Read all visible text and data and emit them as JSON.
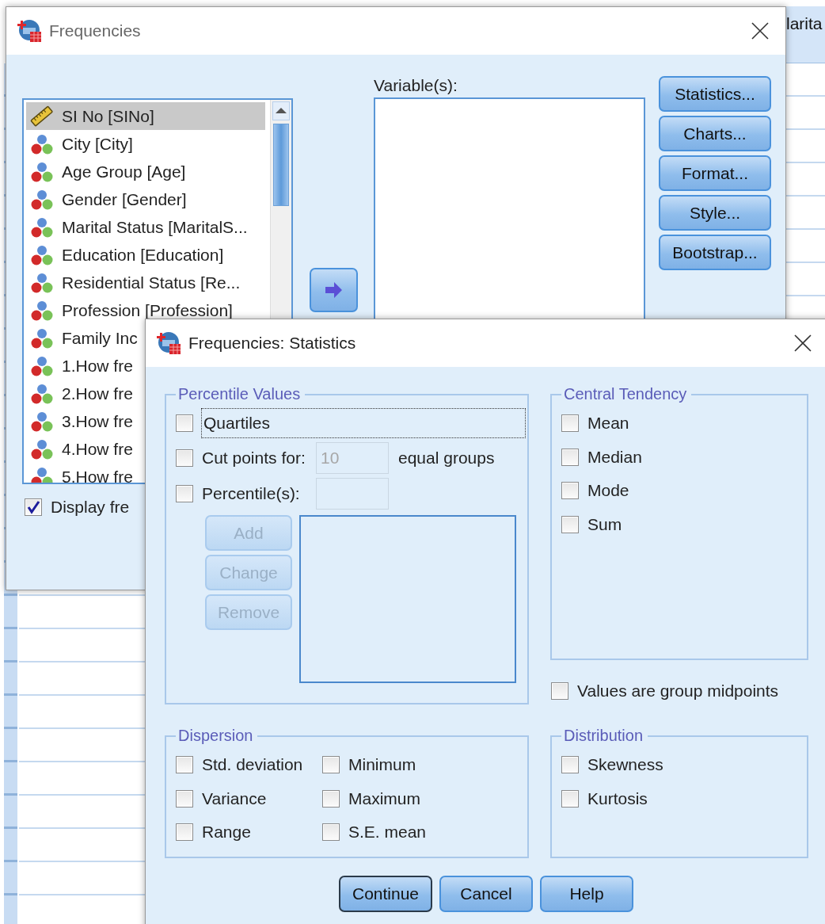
{
  "background_sheet": {
    "column_header": "larita"
  },
  "main_dialog": {
    "title": "Frequencies",
    "source_variables": [
      {
        "label": "SI No [SINo]",
        "kind": "scale",
        "selected": true
      },
      {
        "label": "City [City]",
        "kind": "nominal",
        "selected": false
      },
      {
        "label": "Age Group [Age]",
        "kind": "nominal",
        "selected": false
      },
      {
        "label": "Gender [Gender]",
        "kind": "nominal",
        "selected": false
      },
      {
        "label": "Marital Status [MaritalS...",
        "kind": "nominal",
        "selected": false
      },
      {
        "label": "Education [Education]",
        "kind": "nominal",
        "selected": false
      },
      {
        "label": "Residential Status [Re...",
        "kind": "nominal",
        "selected": false
      },
      {
        "label": "Profession [Profession]",
        "kind": "nominal",
        "selected": false
      },
      {
        "label": "Family Inc",
        "kind": "nominal",
        "selected": false
      },
      {
        "label": "1.How fre",
        "kind": "nominal",
        "selected": false
      },
      {
        "label": "2.How fre",
        "kind": "nominal",
        "selected": false
      },
      {
        "label": "3.How fre",
        "kind": "nominal",
        "selected": false
      },
      {
        "label": "4.How fre",
        "kind": "nominal",
        "selected": false
      },
      {
        "label": "5.How fre",
        "kind": "nominal",
        "selected": false
      }
    ],
    "variables_label": "Variable(s):",
    "side_buttons": [
      "Statistics...",
      "Charts...",
      "Format...",
      "Style...",
      "Bootstrap..."
    ],
    "display_frequency": {
      "label": "Display fre",
      "checked": true
    }
  },
  "statistics_dialog": {
    "title": "Frequencies: Statistics",
    "percentile_values": {
      "legend": "Percentile Values",
      "quartiles": {
        "label": "Quartiles",
        "checked": false,
        "focused": true
      },
      "cut_points": {
        "label": "Cut points for:",
        "checked": false,
        "value": "10",
        "disabled": true,
        "suffix": "equal groups"
      },
      "percentiles": {
        "label": "Percentile(s):",
        "checked": false,
        "disabled": true
      },
      "buttons": [
        {
          "label": "Add",
          "disabled": true
        },
        {
          "label": "Change",
          "disabled": true
        },
        {
          "label": "Remove",
          "disabled": true
        }
      ]
    },
    "central_tendency": {
      "legend": "Central Tendency",
      "options": [
        {
          "label": "Mean",
          "checked": false
        },
        {
          "label": "Median",
          "checked": false
        },
        {
          "label": "Mode",
          "checked": false
        },
        {
          "label": "Sum",
          "checked": false
        }
      ]
    },
    "group_midpoints": {
      "label": "Values are group midpoints",
      "checked": false
    },
    "dispersion": {
      "legend": "Dispersion",
      "options": [
        {
          "label": "Std. deviation",
          "checked": false
        },
        {
          "label": "Minimum",
          "checked": false
        },
        {
          "label": "Variance",
          "checked": false
        },
        {
          "label": "Maximum",
          "checked": false
        },
        {
          "label": "Range",
          "checked": false
        },
        {
          "label": "S.E. mean",
          "checked": false
        }
      ]
    },
    "distribution": {
      "legend": "Distribution",
      "options": [
        {
          "label": "Skewness",
          "checked": false
        },
        {
          "label": "Kurtosis",
          "checked": false
        }
      ]
    },
    "buttons": [
      {
        "label": "Continue",
        "default": true
      },
      {
        "label": "Cancel",
        "default": false
      },
      {
        "label": "Help",
        "default": false
      }
    ]
  }
}
